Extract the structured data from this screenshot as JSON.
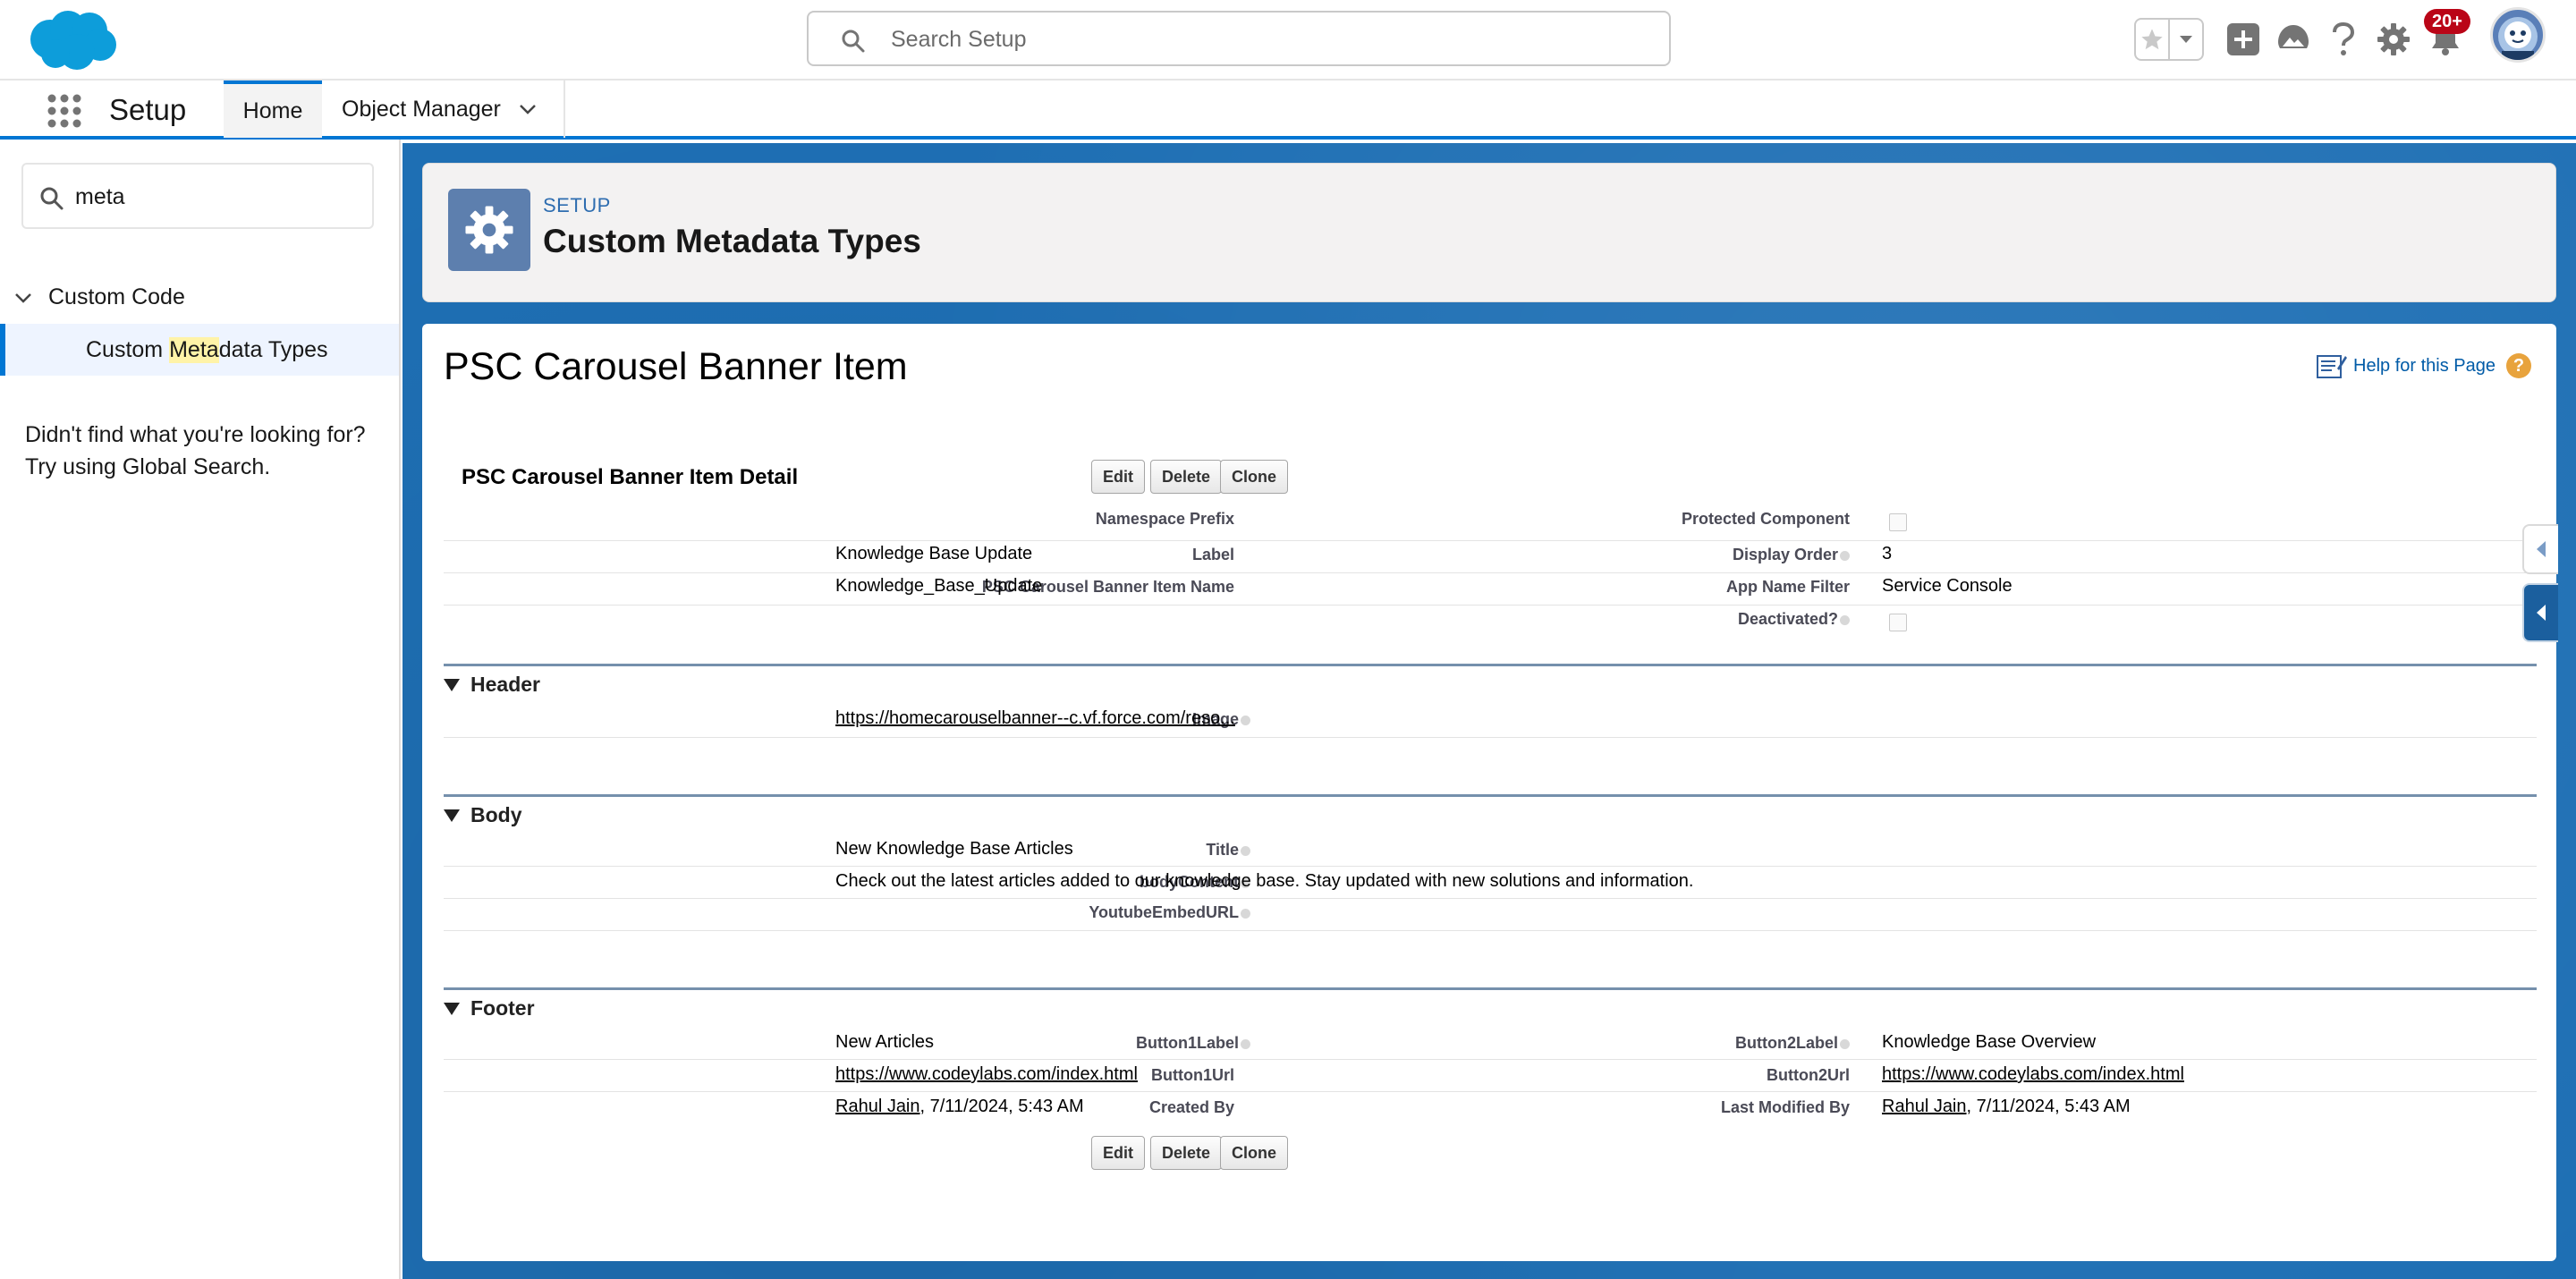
{
  "header": {
    "search_placeholder": "Search Setup",
    "notification_count": "20+",
    "icons": [
      "search-icon",
      "star-icon",
      "chevron-down-icon",
      "add-icon",
      "trailhead-icon",
      "help-icon",
      "gear-icon",
      "bell-icon",
      "avatar"
    ]
  },
  "nav": {
    "app_name": "Setup",
    "tabs": [
      {
        "label": "Home",
        "active": true
      },
      {
        "label": "Object Manager",
        "active": false
      }
    ]
  },
  "sidebar": {
    "quickfind_value": "meta",
    "group_label": "Custom Code",
    "item_prefix": "Custom ",
    "item_highlight": "Meta",
    "item_suffix": "data Types",
    "not_found_line1": "Didn't find what you're looking for?",
    "not_found_line2": "Try using Global Search."
  },
  "page_header": {
    "eyebrow": "SETUP",
    "title": "Custom Metadata Types"
  },
  "record": {
    "title": "PSC Carousel Banner Item",
    "help_link": "Help for this Page",
    "detail_title": "PSC Carousel Banner Item Detail",
    "buttons": {
      "edit": "Edit",
      "delete": "Delete",
      "clone": "Clone"
    },
    "fields": {
      "namespace_prefix": {
        "label": "Namespace Prefix",
        "value": ""
      },
      "protected_component": {
        "label": "Protected Component",
        "checked": false
      },
      "label": {
        "label": "Label",
        "value": "Knowledge Base Update"
      },
      "display_order": {
        "label": "Display Order",
        "value": "3"
      },
      "api_name": {
        "label": "PSC Carousel Banner Item Name",
        "value": "Knowledge_Base_Update"
      },
      "app_name_filter": {
        "label": "App Name Filter",
        "value": "Service Console"
      },
      "deactivated": {
        "label": "Deactivated?",
        "checked": false
      }
    },
    "sections": {
      "header": {
        "title": "Header",
        "image_label": "Image",
        "image_value": "https://homecarouselbanner--c.vf.force.com/reso..."
      },
      "body": {
        "title": "Body",
        "title_label": "Title",
        "title_value": "New Knowledge Base Articles",
        "content_label": "bodyContent",
        "content_value": "Check out the latest articles added to our knowledge base. Stay updated with new solutions and information.",
        "youtube_label": "YoutubeEmbedURL",
        "youtube_value": ""
      },
      "footer": {
        "title": "Footer",
        "button1_label_label": "Button1Label",
        "button1_label_value": "New Articles",
        "button2_label_label": "Button2Label",
        "button2_label_value": "Knowledge Base Overview",
        "button1_url_label": "Button1Url",
        "button1_url_value": "https://www.codeylabs.com/index.html",
        "button2_url_label": "Button2Url",
        "button2_url_value": "https://www.codeylabs.com/index.html",
        "created_by_label": "Created By",
        "created_by_user": "Rahul Jain",
        "created_by_date": ", 7/11/2024, 5:43 AM",
        "modified_by_label": "Last Modified By",
        "modified_by_user": "Rahul Jain",
        "modified_by_date": ", 7/11/2024, 5:43 AM"
      }
    }
  },
  "colors": {
    "brand_blue": "#0176d3",
    "background_blue": "#1e6fb4",
    "notification_red": "#ba0517",
    "section_line": "#7590ac"
  }
}
